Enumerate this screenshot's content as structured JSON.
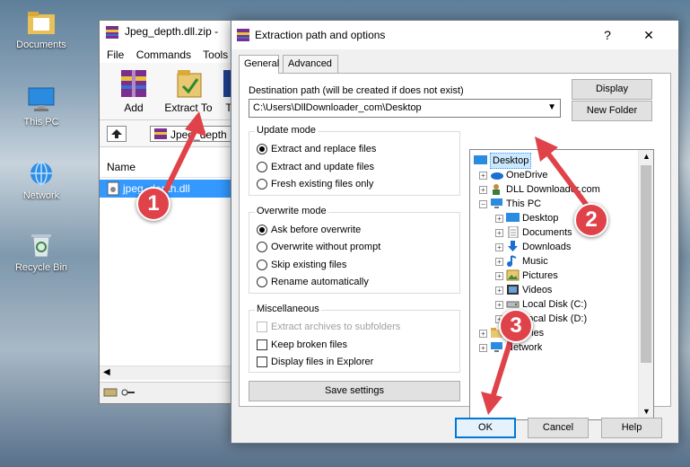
{
  "desktop": {
    "icons": [
      {
        "label": "Documents"
      },
      {
        "label": "This PC"
      },
      {
        "label": "Network"
      },
      {
        "label": "Recycle Bin"
      }
    ]
  },
  "bg_window": {
    "title": "Jpeg_depth.dll.zip -",
    "menu": [
      "File",
      "Commands",
      "Tools"
    ],
    "toolbar": {
      "add": "Add",
      "extract_to": "Extract To",
      "third": "T"
    },
    "address_text": "Jpeg_depth",
    "list_header": "Name",
    "selected_file": "jpeg_depth.dll"
  },
  "dialog": {
    "title": "Extraction path and options",
    "help_glyph": "?",
    "close_glyph": "✕",
    "tabs": [
      "General",
      "Advanced"
    ],
    "dest_label": "Destination path (will be created if does not exist)",
    "dest_value": "C:\\Users\\DllDownloader_com\\Desktop",
    "display_btn": "Display",
    "new_folder_btn": "New Folder",
    "update_mode": {
      "title": "Update mode",
      "options": [
        "Extract and replace files",
        "Extract and update files",
        "Fresh existing files only"
      ],
      "selected": 0
    },
    "overwrite_mode": {
      "title": "Overwrite mode",
      "options": [
        "Ask before overwrite",
        "Overwrite without prompt",
        "Skip existing files",
        "Rename automatically"
      ],
      "selected": 0
    },
    "misc": {
      "title": "Miscellaneous",
      "options": [
        {
          "label": "Extract archives to subfolders",
          "checked": false,
          "disabled": true
        },
        {
          "label": "Keep broken files",
          "checked": false,
          "disabled": false
        },
        {
          "label": "Display files in Explorer",
          "checked": false,
          "disabled": false
        }
      ]
    },
    "save_settings_btn": "Save settings",
    "tree": [
      {
        "label": "Desktop",
        "icon": "desktop-icon",
        "selected": true
      },
      {
        "label": "OneDrive",
        "icon": "onedrive-icon"
      },
      {
        "label": "DLL Downloader.com",
        "icon": "user-icon"
      },
      {
        "label": "This PC",
        "icon": "computer-icon"
      },
      {
        "label": "Desktop",
        "icon": "desktop-icon"
      },
      {
        "label": "Documents",
        "icon": "documents-icon"
      },
      {
        "label": "Downloads",
        "icon": "downloads-icon"
      },
      {
        "label": "Music",
        "icon": "music-icon"
      },
      {
        "label": "Pictures",
        "icon": "pictures-icon"
      },
      {
        "label": "Videos",
        "icon": "videos-icon"
      },
      {
        "label": "Local Disk (C:)",
        "icon": "drive-icon"
      },
      {
        "label": "Local Disk (D:)",
        "icon": "drive-icon"
      },
      {
        "label": "Libraries",
        "icon": "folder-icon"
      },
      {
        "label": "Network",
        "icon": "network-icon"
      }
    ],
    "ok_btn": "OK",
    "cancel_btn": "Cancel",
    "help_btn": "Help"
  },
  "annotations": [
    {
      "number": "1"
    },
    {
      "number": "2"
    },
    {
      "number": "3"
    }
  ],
  "colors": {
    "annotation_red": "#e0424a",
    "selection_blue": "#3399ff",
    "accent": "#0078d7"
  }
}
